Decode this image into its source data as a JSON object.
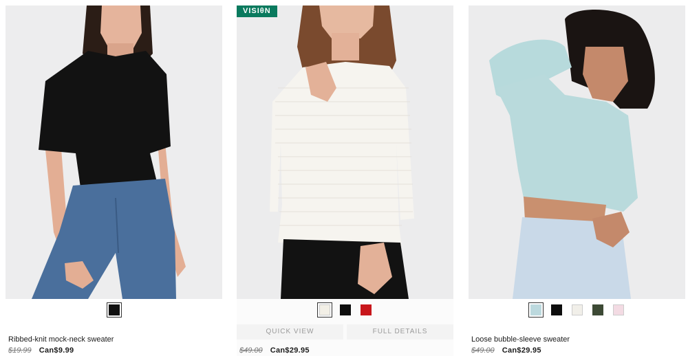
{
  "products": [
    {
      "name": "Ribbed-knit mock-neck sweater",
      "price_original": "$19.99",
      "price_sale": "Can$9.99",
      "swatches": [
        {
          "color": "#111111",
          "selected": true
        }
      ]
    },
    {
      "badge": "VISIθN",
      "name": "",
      "price_original": "$49.00",
      "price_sale": "Can$29.95",
      "quick_view_label": "QUICK VIEW",
      "full_details_label": "FULL DETAILS",
      "swatches": [
        {
          "color": "#f2efe6",
          "selected": true
        },
        {
          "color": "#0d0d0d",
          "selected": false
        },
        {
          "color": "#c8161b",
          "selected": false
        }
      ]
    },
    {
      "name": "Loose bubble-sleeve sweater",
      "price_original": "$49.00",
      "price_sale": "Can$29.95",
      "swatches": [
        {
          "color": "#bcd9de",
          "selected": true
        },
        {
          "color": "#0d0d0d",
          "selected": false
        },
        {
          "color": "#f1efe9",
          "selected": false
        },
        {
          "color": "#3d4a35",
          "selected": false
        },
        {
          "color": "#f3dbe3",
          "selected": false
        }
      ]
    }
  ]
}
